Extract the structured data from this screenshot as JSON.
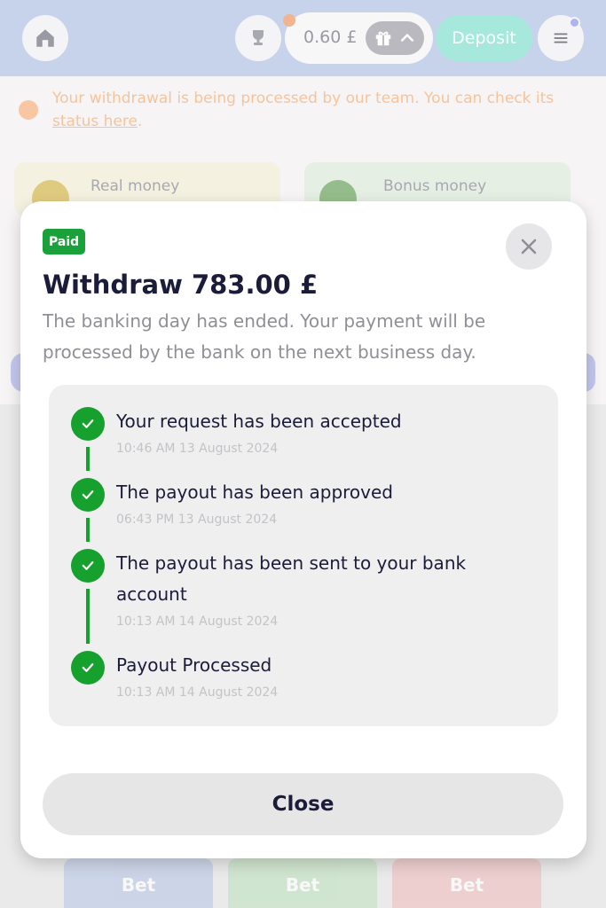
{
  "header": {
    "balance": "0.60 £",
    "deposit_label": "Deposit"
  },
  "notice": {
    "text": "Your withdrawal is being processed by our team. You can check its ",
    "link": "status here",
    "suffix": "."
  },
  "wallet": {
    "real_money_label": "Real money",
    "bonus_money_label": "Bonus money"
  },
  "bottom_tabs": [
    "Bet",
    "Bet",
    "Bet"
  ],
  "modal": {
    "badge": "Paid",
    "title": "Withdraw 783.00 £",
    "description": "The banking day has ended. Your payment will be processed by the bank on the next business day.",
    "steps": [
      {
        "title": "Your request has been accepted",
        "time": "10:46 AM 13 August 2024"
      },
      {
        "title": "The payout has been approved",
        "time": "06:43 PM 13 August 2024"
      },
      {
        "title": "The payout has been sent to your bank account",
        "time": "10:13 AM 14 August 2024"
      },
      {
        "title": "Payout Processed",
        "time": "10:13 AM 14 August 2024"
      }
    ],
    "close_label": "Close"
  },
  "colors": {
    "success": "#16a02d",
    "badge": "#1aa13a",
    "deposit": "#a6e9dc",
    "notice": "#f7c39b"
  },
  "icons": [
    "home-icon",
    "trophy-icon",
    "gift-icon",
    "chevron-up-icon",
    "menu-icon",
    "clock-icon",
    "coin-icon",
    "close-icon",
    "check-icon"
  ]
}
